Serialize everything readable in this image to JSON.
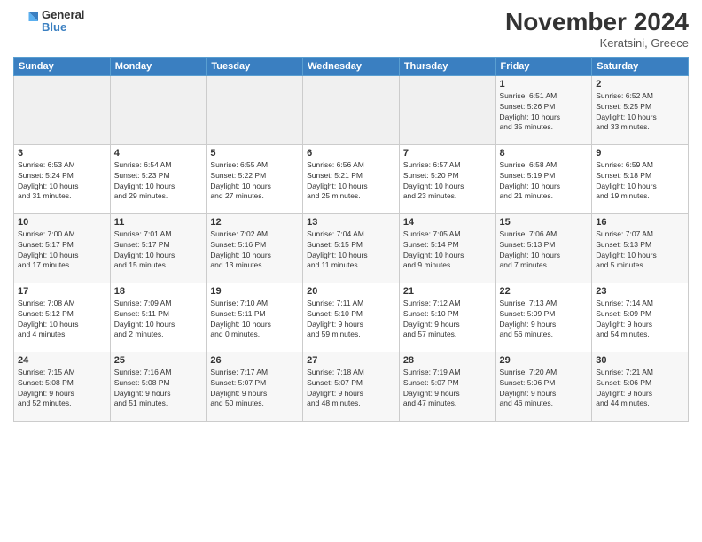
{
  "logo": {
    "general": "General",
    "blue": "Blue"
  },
  "header": {
    "month": "November 2024",
    "location": "Keratsini, Greece"
  },
  "weekdays": [
    "Sunday",
    "Monday",
    "Tuesday",
    "Wednesday",
    "Thursday",
    "Friday",
    "Saturday"
  ],
  "weeks": [
    [
      {
        "day": "",
        "info": ""
      },
      {
        "day": "",
        "info": ""
      },
      {
        "day": "",
        "info": ""
      },
      {
        "day": "",
        "info": ""
      },
      {
        "day": "",
        "info": ""
      },
      {
        "day": "1",
        "info": "Sunrise: 6:51 AM\nSunset: 5:26 PM\nDaylight: 10 hours\nand 35 minutes."
      },
      {
        "day": "2",
        "info": "Sunrise: 6:52 AM\nSunset: 5:25 PM\nDaylight: 10 hours\nand 33 minutes."
      }
    ],
    [
      {
        "day": "3",
        "info": "Sunrise: 6:53 AM\nSunset: 5:24 PM\nDaylight: 10 hours\nand 31 minutes."
      },
      {
        "day": "4",
        "info": "Sunrise: 6:54 AM\nSunset: 5:23 PM\nDaylight: 10 hours\nand 29 minutes."
      },
      {
        "day": "5",
        "info": "Sunrise: 6:55 AM\nSunset: 5:22 PM\nDaylight: 10 hours\nand 27 minutes."
      },
      {
        "day": "6",
        "info": "Sunrise: 6:56 AM\nSunset: 5:21 PM\nDaylight: 10 hours\nand 25 minutes."
      },
      {
        "day": "7",
        "info": "Sunrise: 6:57 AM\nSunset: 5:20 PM\nDaylight: 10 hours\nand 23 minutes."
      },
      {
        "day": "8",
        "info": "Sunrise: 6:58 AM\nSunset: 5:19 PM\nDaylight: 10 hours\nand 21 minutes."
      },
      {
        "day": "9",
        "info": "Sunrise: 6:59 AM\nSunset: 5:18 PM\nDaylight: 10 hours\nand 19 minutes."
      }
    ],
    [
      {
        "day": "10",
        "info": "Sunrise: 7:00 AM\nSunset: 5:17 PM\nDaylight: 10 hours\nand 17 minutes."
      },
      {
        "day": "11",
        "info": "Sunrise: 7:01 AM\nSunset: 5:17 PM\nDaylight: 10 hours\nand 15 minutes."
      },
      {
        "day": "12",
        "info": "Sunrise: 7:02 AM\nSunset: 5:16 PM\nDaylight: 10 hours\nand 13 minutes."
      },
      {
        "day": "13",
        "info": "Sunrise: 7:04 AM\nSunset: 5:15 PM\nDaylight: 10 hours\nand 11 minutes."
      },
      {
        "day": "14",
        "info": "Sunrise: 7:05 AM\nSunset: 5:14 PM\nDaylight: 10 hours\nand 9 minutes."
      },
      {
        "day": "15",
        "info": "Sunrise: 7:06 AM\nSunset: 5:13 PM\nDaylight: 10 hours\nand 7 minutes."
      },
      {
        "day": "16",
        "info": "Sunrise: 7:07 AM\nSunset: 5:13 PM\nDaylight: 10 hours\nand 5 minutes."
      }
    ],
    [
      {
        "day": "17",
        "info": "Sunrise: 7:08 AM\nSunset: 5:12 PM\nDaylight: 10 hours\nand 4 minutes."
      },
      {
        "day": "18",
        "info": "Sunrise: 7:09 AM\nSunset: 5:11 PM\nDaylight: 10 hours\nand 2 minutes."
      },
      {
        "day": "19",
        "info": "Sunrise: 7:10 AM\nSunset: 5:11 PM\nDaylight: 10 hours\nand 0 minutes."
      },
      {
        "day": "20",
        "info": "Sunrise: 7:11 AM\nSunset: 5:10 PM\nDaylight: 9 hours\nand 59 minutes."
      },
      {
        "day": "21",
        "info": "Sunrise: 7:12 AM\nSunset: 5:10 PM\nDaylight: 9 hours\nand 57 minutes."
      },
      {
        "day": "22",
        "info": "Sunrise: 7:13 AM\nSunset: 5:09 PM\nDaylight: 9 hours\nand 56 minutes."
      },
      {
        "day": "23",
        "info": "Sunrise: 7:14 AM\nSunset: 5:09 PM\nDaylight: 9 hours\nand 54 minutes."
      }
    ],
    [
      {
        "day": "24",
        "info": "Sunrise: 7:15 AM\nSunset: 5:08 PM\nDaylight: 9 hours\nand 52 minutes."
      },
      {
        "day": "25",
        "info": "Sunrise: 7:16 AM\nSunset: 5:08 PM\nDaylight: 9 hours\nand 51 minutes."
      },
      {
        "day": "26",
        "info": "Sunrise: 7:17 AM\nSunset: 5:07 PM\nDaylight: 9 hours\nand 50 minutes."
      },
      {
        "day": "27",
        "info": "Sunrise: 7:18 AM\nSunset: 5:07 PM\nDaylight: 9 hours\nand 48 minutes."
      },
      {
        "day": "28",
        "info": "Sunrise: 7:19 AM\nSunset: 5:07 PM\nDaylight: 9 hours\nand 47 minutes."
      },
      {
        "day": "29",
        "info": "Sunrise: 7:20 AM\nSunset: 5:06 PM\nDaylight: 9 hours\nand 46 minutes."
      },
      {
        "day": "30",
        "info": "Sunrise: 7:21 AM\nSunset: 5:06 PM\nDaylight: 9 hours\nand 44 minutes."
      }
    ]
  ]
}
